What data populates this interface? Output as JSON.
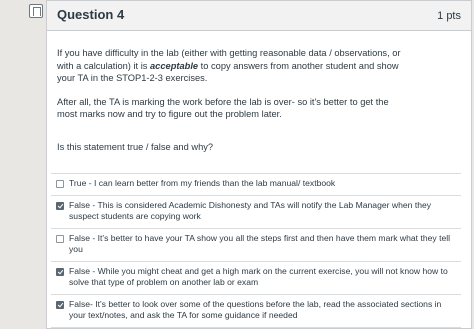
{
  "question": {
    "title": "Question 4",
    "points": "1 pts",
    "para1_before": "If you have difficulty in the lab (either with getting reasonable data / observations, or with a calculation) it is ",
    "para1_emph": "acceptable",
    "para1_after": " to copy answers from another student and show your TA in the STOP1-2-3 exercises.",
    "para2": "After all, the TA is marking the work before the lab is over- so it's better to get the most marks now and try to figure out the problem later.",
    "prompt": "Is this statement  true / false and why?"
  },
  "answers": [
    {
      "text": "True - I can learn better from my friends than the lab manual/ textbook",
      "checked": false
    },
    {
      "text": "False - This is considered Academic Dishonesty and TAs will notify the Lab Manager when they suspect students are copying work",
      "checked": true
    },
    {
      "text": "False - It's better to have your TA show you all the steps first and then have them mark what they tell you",
      "checked": false
    },
    {
      "text": "False - While you might cheat and get a high mark on the current exercise, you will not know how to solve that type of problem on another lab or exam",
      "checked": true
    },
    {
      "text": "False- It's better to look over some of the questions before the lab, read the associated sections in your text/notes, and ask the TA for some guidance if needed",
      "checked": true
    }
  ]
}
